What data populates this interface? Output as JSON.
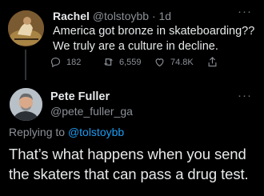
{
  "parent_tweet": {
    "author_name": "Rachel",
    "author_handle": "@tolstoybb",
    "separator": "·",
    "time": "1d",
    "text": "America got bronze in skateboarding?? We truly are a culture in decline.",
    "replies": "182",
    "retweets": "6,559",
    "likes": "74.8K",
    "more_label": "···"
  },
  "main_tweet": {
    "author_name": "Pete Fuller",
    "author_handle": "@pete_fuller_ga",
    "replying_prefix": "Replying to",
    "replying_to": "@tolstoybb",
    "text": "That’s what happens when you send the skaters that can pass a drug test.",
    "more_label": "···"
  },
  "colors": {
    "background": "#000000",
    "text_primary": "#e7e9ea",
    "text_secondary": "#8b9096",
    "link": "#1d9bf0"
  }
}
